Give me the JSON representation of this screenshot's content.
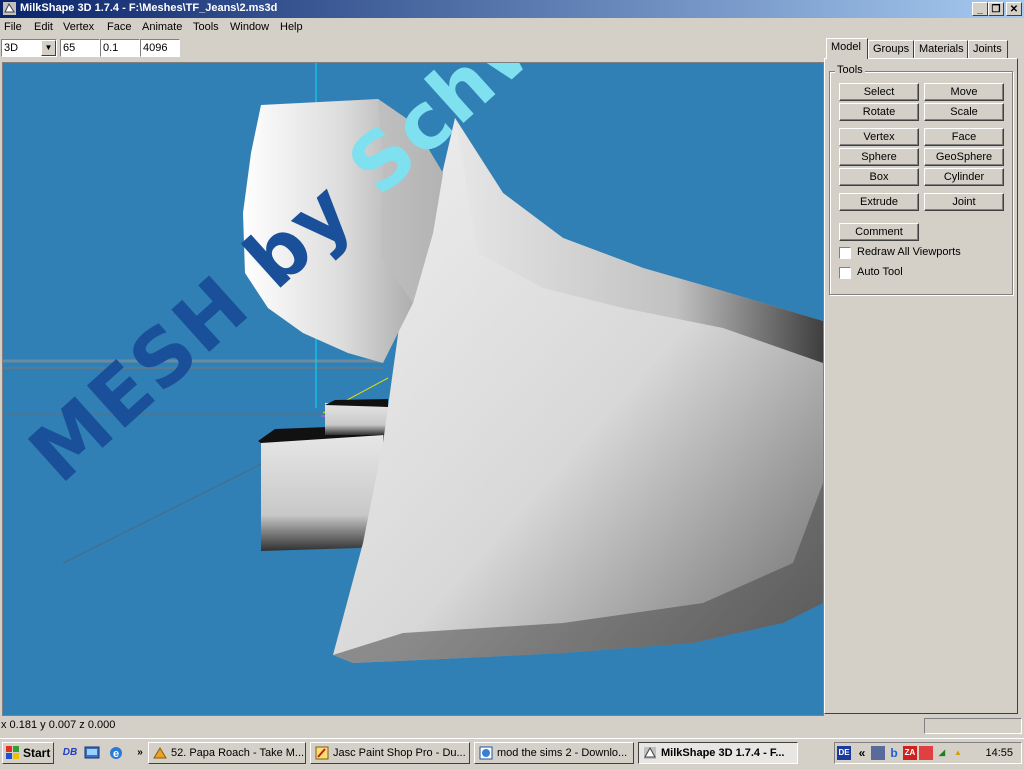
{
  "window": {
    "title": "MilkShape 3D 1.7.4 - F:\\Meshes\\TF_Jeans\\2.ms3d"
  },
  "menu": [
    "File",
    "Edit",
    "Vertex",
    "Face",
    "Animate",
    "Tools",
    "Window",
    "Help"
  ],
  "toolbar": {
    "view_mode": "3D",
    "field1": "65",
    "field2": "0.1",
    "field3": "4096"
  },
  "watermark": {
    "part1": "MESH by ",
    "part2": "Schwerelos"
  },
  "status": {
    "coords": "x 0.181 y 0.007 z 0.000"
  },
  "panel": {
    "tabs": [
      "Model",
      "Groups",
      "Materials",
      "Joints"
    ],
    "group_label": "Tools",
    "buttons": {
      "select": "Select",
      "move": "Move",
      "rotate": "Rotate",
      "scale": "Scale",
      "vertex": "Vertex",
      "face": "Face",
      "sphere": "Sphere",
      "geosphere": "GeoSphere",
      "box": "Box",
      "cylinder": "Cylinder",
      "extrude": "Extrude",
      "joint": "Joint",
      "comment": "Comment"
    },
    "checkboxes": {
      "redraw": "Redraw All Viewports",
      "autotool": "Auto Tool"
    }
  },
  "taskbar": {
    "start": "Start",
    "chevron": "»",
    "tasks": [
      "52. Papa Roach - Take M...",
      "Jasc Paint Shop Pro - Du...",
      "mod the sims 2 - Downlo...",
      "MilkShape 3D 1.7.4 - F..."
    ],
    "tray_lang": "DE",
    "tray_chevron": "«",
    "clock": "14:55"
  }
}
